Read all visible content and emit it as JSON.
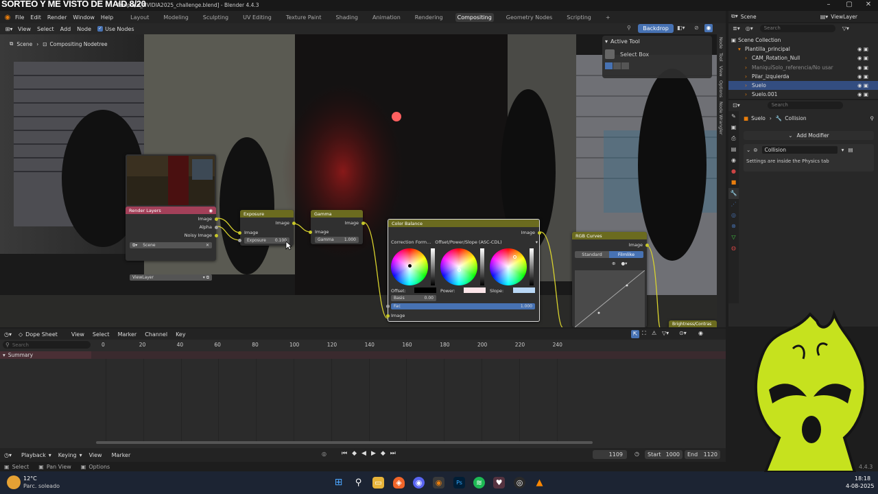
{
  "titlebar": {
    "overlay": "SORTEO Y ME VISTO DE MAID 8/20",
    "title": "Template_NVIDIA2025_challenge.blend] - Blender 4.4.3"
  },
  "menubar": {
    "items": [
      "File",
      "Edit",
      "Render",
      "Window",
      "Help"
    ],
    "workspaces": [
      "Layout",
      "Modeling",
      "Sculpting",
      "UV Editing",
      "Texture Paint",
      "Shading",
      "Animation",
      "Rendering",
      "Compositing",
      "Geometry Nodes",
      "Scripting"
    ],
    "active_workspace": "Compositing",
    "add_tab": "+",
    "scene_label": "Scene",
    "viewlayer_label": "ViewLayer"
  },
  "node_header": {
    "menus": [
      "View",
      "Select",
      "Add",
      "Node"
    ],
    "use_nodes": "Use Nodes",
    "backdrop": "Backdrop",
    "breadcrumb": [
      "Scene",
      "Compositing Nodetree"
    ]
  },
  "side_tabs": [
    "Node",
    "Tool",
    "View",
    "Options",
    "Node Wrangler"
  ],
  "active_tool": {
    "title": "Active Tool",
    "tool": "Select Box"
  },
  "nodes": {
    "render_layers": {
      "title": "Render Layers",
      "outputs": [
        "Image",
        "Alpha",
        "Noisy Image"
      ],
      "scene": "Scene",
      "view_layer": "ViewLayer"
    },
    "exposure": {
      "title": "Exposure",
      "output": "Image",
      "input": "Image",
      "field_label": "Exposure",
      "field_value": "0.100"
    },
    "gamma": {
      "title": "Gamma",
      "output": "Image",
      "input": "Image",
      "field_label": "Gamma",
      "field_value": "1.000"
    },
    "color_balance": {
      "title": "Color Balance",
      "output": "Image",
      "correction_label": "Correction Form...",
      "correction_value": "Offset/Power/Slope (ASC-CDL)",
      "offset_label": "Offset:",
      "power_label": "Power:",
      "slope_label": "Slope:",
      "basis_label": "Basis",
      "basis_value": "0.00",
      "fac_label": "Fac",
      "fac_value": "1.000",
      "input": "Image"
    },
    "rgb_curves": {
      "title": "RGB Curves",
      "output": "Image",
      "tab_standard": "Standard",
      "tab_filmlike": "Filmlike"
    },
    "brightness": {
      "title": "Brightness/Contras"
    }
  },
  "outliner": {
    "search_placeholder": "Search",
    "rows": [
      {
        "label": "Scene Collection",
        "indent": 0
      },
      {
        "label": "Plantilla_principal",
        "indent": 1
      },
      {
        "label": "CAM_Rotation_Null",
        "indent": 2
      },
      {
        "label": "ManiquíSolo_referencia/No usar",
        "indent": 2
      },
      {
        "label": "Pilar_izquierda",
        "indent": 2
      },
      {
        "label": "Suelo",
        "indent": 2
      },
      {
        "label": "Suelo.001",
        "indent": 2
      }
    ]
  },
  "properties": {
    "search_placeholder": "Search",
    "breadcrumb_object": "Suelo",
    "breadcrumb_modifier": "Collision",
    "add_modifier": "Add Modifier",
    "modifier_name": "Collision",
    "modifier_note": "Settings are inside the Physics tab"
  },
  "dopesheet": {
    "mode": "Dope Sheet",
    "menus": [
      "View",
      "Select",
      "Marker",
      "Channel",
      "Key"
    ],
    "search_placeholder": "Search",
    "frames": [
      "0",
      "20",
      "40",
      "60",
      "80",
      "100",
      "120",
      "140",
      "160",
      "180",
      "200",
      "220",
      "240"
    ],
    "summary": "Summary"
  },
  "timeline": {
    "menus": [
      "Playback",
      "Keying",
      "View",
      "Marker"
    ],
    "current_frame": "1109",
    "start_label": "Start",
    "start_value": "1000",
    "end_label": "End",
    "end_value": "1120"
  },
  "statusbar": {
    "select": "Select",
    "pan": "Pan View",
    "options": "Options",
    "version": "4.4.3"
  },
  "taskbar": {
    "weather_temp": "12°C",
    "weather_desc": "Parc. soleado",
    "time": "18:18",
    "date": "4-08-2025"
  },
  "colors": {
    "accent": "#4772b3",
    "selection": "#334d80",
    "node_header_green": "#6b6b1f",
    "render_layers_header": "#a34059",
    "socket_yellow": "#c7c729",
    "active_tab": "#3a3a3a",
    "mascot_green": "#c6e21e"
  }
}
